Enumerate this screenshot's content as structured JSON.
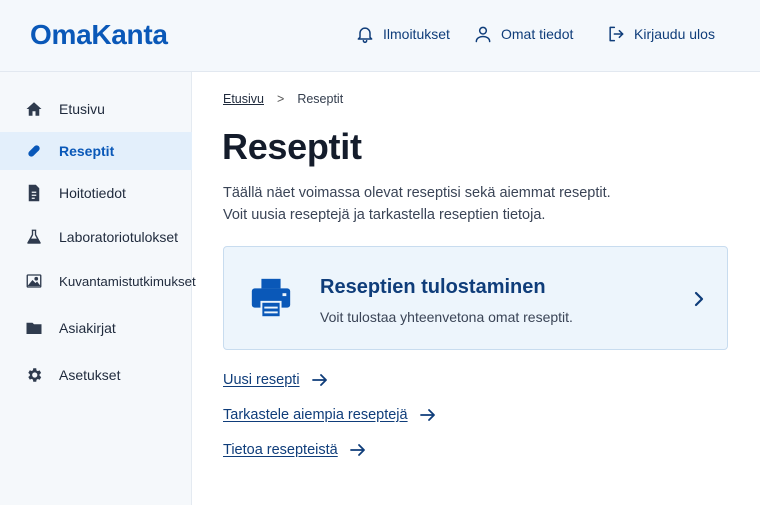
{
  "header": {
    "logo": "OmaKanta",
    "notifications_label": "Ilmoitukset",
    "profile_label": "Omat tiedot",
    "logout_label": "Kirjaudu ulos"
  },
  "sidebar": {
    "items": [
      {
        "label": "Etusivu",
        "icon": "home-icon"
      },
      {
        "label": "Reseptit",
        "icon": "pill-icon",
        "active": true
      },
      {
        "label": "Hoitotiedot",
        "icon": "document-icon"
      },
      {
        "label": "Laboratoriotulokset",
        "icon": "flask-icon"
      },
      {
        "label": "Kuvantamistutkimukset",
        "icon": "image-icon"
      },
      {
        "label": "Asiakirjat",
        "icon": "folder-icon"
      },
      {
        "label": "Asetukset",
        "icon": "gear-icon"
      }
    ]
  },
  "breadcrumb": {
    "home": "Etusivu",
    "current": "Reseptit"
  },
  "main": {
    "title": "Reseptit",
    "intro_line1": "Täällä näet voimassa olevat reseptisi sekä aiemmat reseptit.",
    "intro_line2": "Voit uusia reseptejä ja tarkastella reseptien tietoja.",
    "print_card": {
      "title": "Reseptien tulostaminen",
      "description": "Voit tulostaa yhteenvetona omat reseptit.",
      "icon": "printer-icon"
    },
    "links": [
      {
        "label": "Uusi resepti"
      },
      {
        "label": "Tarkastele aiempia reseptejä"
      },
      {
        "label": "Tietoa resepteistä"
      }
    ]
  },
  "colors": {
    "brand": "#0a58b8",
    "link": "#0f3d7a",
    "active_bg": "#e3effb",
    "card_bg": "#edf5fc"
  }
}
